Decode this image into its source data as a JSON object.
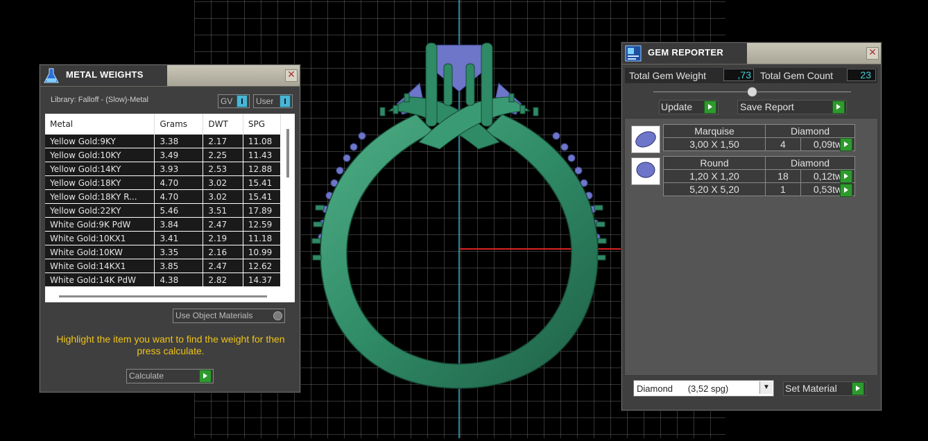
{
  "metal_weights": {
    "title": "METAL WEIGHTS",
    "library_label": "Library: Falloff - (Slow)-Metal",
    "gv_label": "GV",
    "user_label": "User",
    "columns": [
      "Metal",
      "Grams",
      "DWT",
      "SPG"
    ],
    "rows": [
      [
        "Yellow Gold:9KY",
        "3.38",
        "2.17",
        "11.08"
      ],
      [
        "Yellow Gold:10KY",
        "3.49",
        "2.25",
        "11.43"
      ],
      [
        "Yellow Gold:14KY",
        "3.93",
        "2.53",
        "12.88"
      ],
      [
        "Yellow Gold:18KY",
        "4.70",
        "3.02",
        "15.41"
      ],
      [
        "Yellow Gold:18KY R...",
        "4.70",
        "3.02",
        "15.41"
      ],
      [
        "Yellow Gold:22KY",
        "5.46",
        "3.51",
        "17.89"
      ],
      [
        "White Gold:9K PdW",
        "3.84",
        "2.47",
        "12.59"
      ],
      [
        "White Gold:10KX1",
        "3.41",
        "2.19",
        "11.18"
      ],
      [
        "White Gold:10KW",
        "3.35",
        "2.16",
        "10.99"
      ],
      [
        "White Gold:14KX1",
        "3.85",
        "2.47",
        "12.62"
      ],
      [
        "White Gold:14K PdW",
        "4.38",
        "2.82",
        "14.37"
      ]
    ],
    "use_object_materials": "Use Object Materials",
    "hint": "Highlight the item you want to find the weight for then press calculate.",
    "calculate_label": "Calculate"
  },
  "gem_reporter": {
    "title": "GEM REPORTER",
    "total_weight_label": "Total Gem Weight",
    "total_weight_value": ",73",
    "total_count_label": "Total Gem Count",
    "total_count_value": "23",
    "update_label": "Update",
    "save_report_label": "Save Report",
    "gems": [
      {
        "shape": "Marquise",
        "material": "Diamond",
        "rows": [
          [
            "3,00 X 1,50",
            "4",
            "0,09tw"
          ]
        ]
      },
      {
        "shape": "Round",
        "material": "Diamond",
        "rows": [
          [
            "1,20 X 1,20",
            "18",
            "0,12tw"
          ],
          [
            "5,20 X 5,20",
            "1",
            "0,53tw"
          ]
        ]
      }
    ],
    "material_select": "Diamond      (3,52 spg)",
    "set_material_label": "Set Material"
  },
  "colors": {
    "ring": "#2f8a66",
    "gem": "#6d76c8",
    "hint_text": "#f0c419",
    "value_text": "#3fd0d8"
  }
}
